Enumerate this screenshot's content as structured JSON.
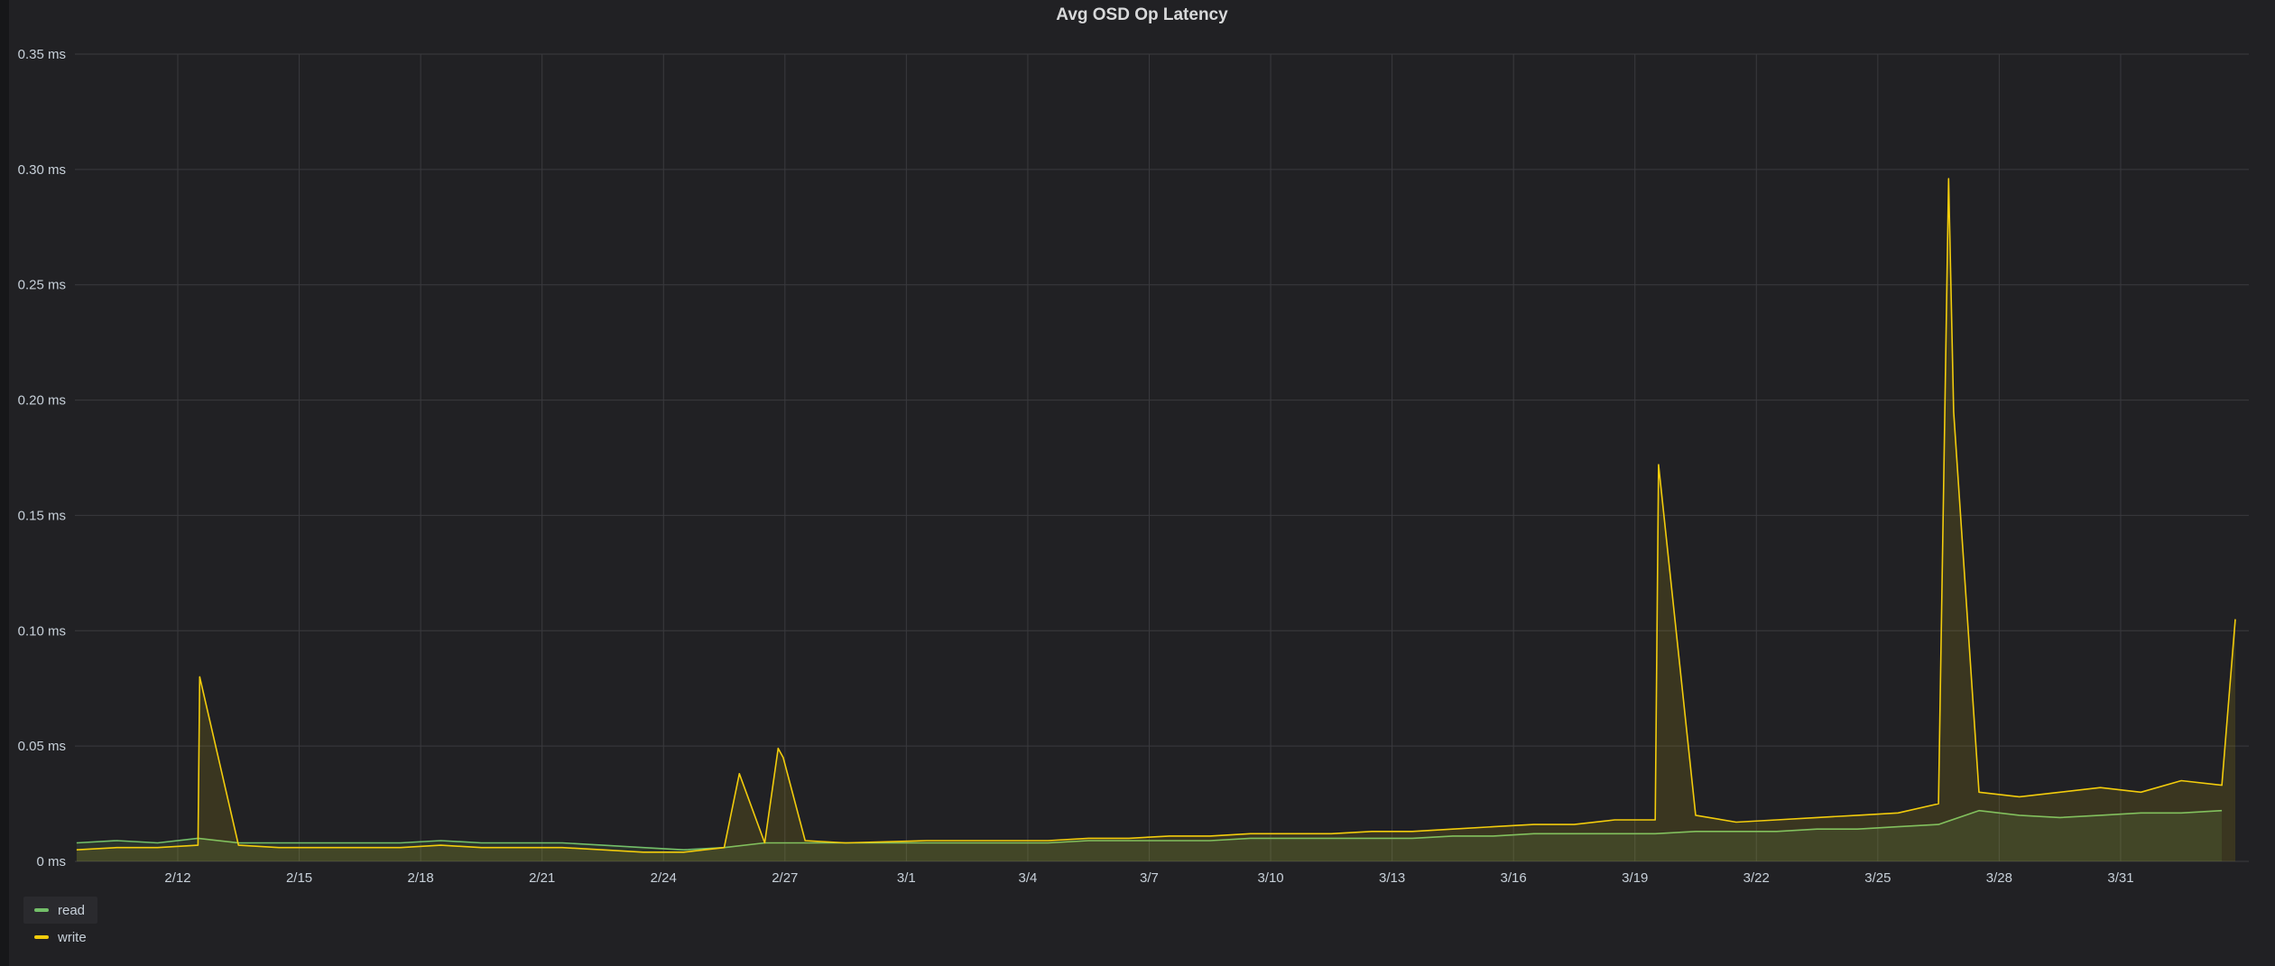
{
  "panel": {
    "title": "Avg OSD Op Latency"
  },
  "colors": {
    "panel_bg": "#212124",
    "grid": "#3a3a3e",
    "read": "#73bf69",
    "write": "#f2cc0c"
  },
  "legend": {
    "items": [
      {
        "label": "read",
        "color": "#73bf69"
      },
      {
        "label": "write",
        "color": "#f2cc0c"
      }
    ]
  },
  "chart_data": {
    "type": "line",
    "title": "Avg OSD Op Latency",
    "xlabel": "",
    "ylabel": "",
    "ylim": [
      0,
      0.35
    ],
    "y_unit": "ms",
    "y_ticks": [
      0,
      0.05,
      0.1,
      0.15,
      0.2,
      0.25,
      0.3,
      0.35
    ],
    "y_tick_labels": [
      "0 ms",
      "0.05 ms",
      "0.10 ms",
      "0.15 ms",
      "0.20 ms",
      "0.25 ms",
      "0.30 ms",
      "0.35 ms"
    ],
    "x_ticks": [
      "2/12",
      "2/15",
      "2/18",
      "2/21",
      "2/24",
      "2/27",
      "3/1",
      "3/4",
      "3/7",
      "3/10",
      "3/13",
      "3/16",
      "3/19",
      "3/22",
      "3/25",
      "3/28",
      "3/31"
    ],
    "xlim": [
      "2/9 11:00",
      "4/3 04:00"
    ],
    "grid": true,
    "legend_position": "bottom-left",
    "area_fill": true,
    "series": [
      {
        "name": "read",
        "color": "#73bf69",
        "x": [
          "2/9 12:00",
          "2/10 12:00",
          "2/11 12:00",
          "2/12 12:00",
          "2/13 12:00",
          "2/14 12:00",
          "2/15 12:00",
          "2/16 12:00",
          "2/17 12:00",
          "2/18 12:00",
          "2/19 12:00",
          "2/20 12:00",
          "2/21 12:00",
          "2/22 12:00",
          "2/23 12:00",
          "2/24 12:00",
          "2/25 12:00",
          "2/26 12:00",
          "2/27 12:00",
          "2/28 12:00",
          "3/1 12:00",
          "3/2 12:00",
          "3/3 12:00",
          "3/4 12:00",
          "3/5 12:00",
          "3/6 12:00",
          "3/7 12:00",
          "3/8 12:00",
          "3/9 12:00",
          "3/10 12:00",
          "3/11 12:00",
          "3/12 12:00",
          "3/13 12:00",
          "3/14 12:00",
          "3/15 12:00",
          "3/16 12:00",
          "3/17 12:00",
          "3/18 12:00",
          "3/19 12:00",
          "3/20 12:00",
          "3/21 12:00",
          "3/22 12:00",
          "3/23 12:00",
          "3/24 12:00",
          "3/25 12:00",
          "3/26 12:00",
          "3/27 12:00",
          "3/28 12:00",
          "3/29 12:00",
          "3/30 12:00",
          "3/31 12:00",
          "4/1 12:00",
          "4/2 12:00"
        ],
        "y": [
          0.008,
          0.009,
          0.008,
          0.01,
          0.008,
          0.008,
          0.008,
          0.008,
          0.008,
          0.009,
          0.008,
          0.008,
          0.008,
          0.007,
          0.006,
          0.005,
          0.006,
          0.008,
          0.008,
          0.008,
          0.008,
          0.008,
          0.008,
          0.008,
          0.009,
          0.009,
          0.009,
          0.009,
          0.01,
          0.01,
          0.01,
          0.01,
          0.01,
          0.011,
          0.011,
          0.012,
          0.012,
          0.012,
          0.012,
          0.013,
          0.013,
          0.013,
          0.014,
          0.014,
          0.015,
          0.016,
          0.022,
          0.02,
          0.019,
          0.02,
          0.021,
          0.021,
          0.022
        ]
      },
      {
        "name": "write",
        "color": "#f2cc0c",
        "x": [
          "2/9 12:00",
          "2/10 12:00",
          "2/11 12:00",
          "2/12 12:00",
          "2/12 13:00",
          "2/13 12:00",
          "2/14 12:00",
          "2/15 12:00",
          "2/16 12:00",
          "2/17 12:00",
          "2/18 12:00",
          "2/19 12:00",
          "2/20 12:00",
          "2/21 12:00",
          "2/22 12:00",
          "2/23 12:00",
          "2/24 12:00",
          "2/25 12:00",
          "2/25 21:00",
          "2/26 12:00",
          "2/26 20:00",
          "2/26 23:00",
          "2/27 12:00",
          "2/28 12:00",
          "3/1 12:00",
          "3/2 12:00",
          "3/3 12:00",
          "3/4 12:00",
          "3/5 12:00",
          "3/6 12:00",
          "3/7 12:00",
          "3/8 12:00",
          "3/9 12:00",
          "3/10 12:00",
          "3/11 12:00",
          "3/12 12:00",
          "3/13 12:00",
          "3/14 12:00",
          "3/15 12:00",
          "3/16 12:00",
          "3/17 12:00",
          "3/18 12:00",
          "3/19 12:00",
          "3/19 14:00",
          "3/20 12:00",
          "3/21 12:00",
          "3/22 12:00",
          "3/23 12:00",
          "3/24 12:00",
          "3/25 12:00",
          "3/26 12:00",
          "3/26 18:00",
          "3/26 21:00",
          "3/27 12:00",
          "3/28 12:00",
          "3/29 12:00",
          "3/30 12:00",
          "3/31 12:00",
          "4/1 12:00",
          "4/2 12:00",
          "4/2 20:00"
        ],
        "y": [
          0.005,
          0.006,
          0.006,
          0.007,
          0.08,
          0.007,
          0.006,
          0.006,
          0.006,
          0.006,
          0.007,
          0.006,
          0.006,
          0.006,
          0.005,
          0.004,
          0.004,
          0.006,
          0.038,
          0.008,
          0.049,
          0.045,
          0.009,
          0.008,
          0.009,
          0.009,
          0.009,
          0.009,
          0.01,
          0.01,
          0.011,
          0.011,
          0.012,
          0.012,
          0.012,
          0.013,
          0.013,
          0.014,
          0.015,
          0.016,
          0.016,
          0.018,
          0.018,
          0.172,
          0.02,
          0.017,
          0.018,
          0.019,
          0.02,
          0.021,
          0.025,
          0.296,
          0.195,
          0.03,
          0.028,
          0.03,
          0.032,
          0.03,
          0.035,
          0.033,
          0.105
        ]
      }
    ]
  }
}
